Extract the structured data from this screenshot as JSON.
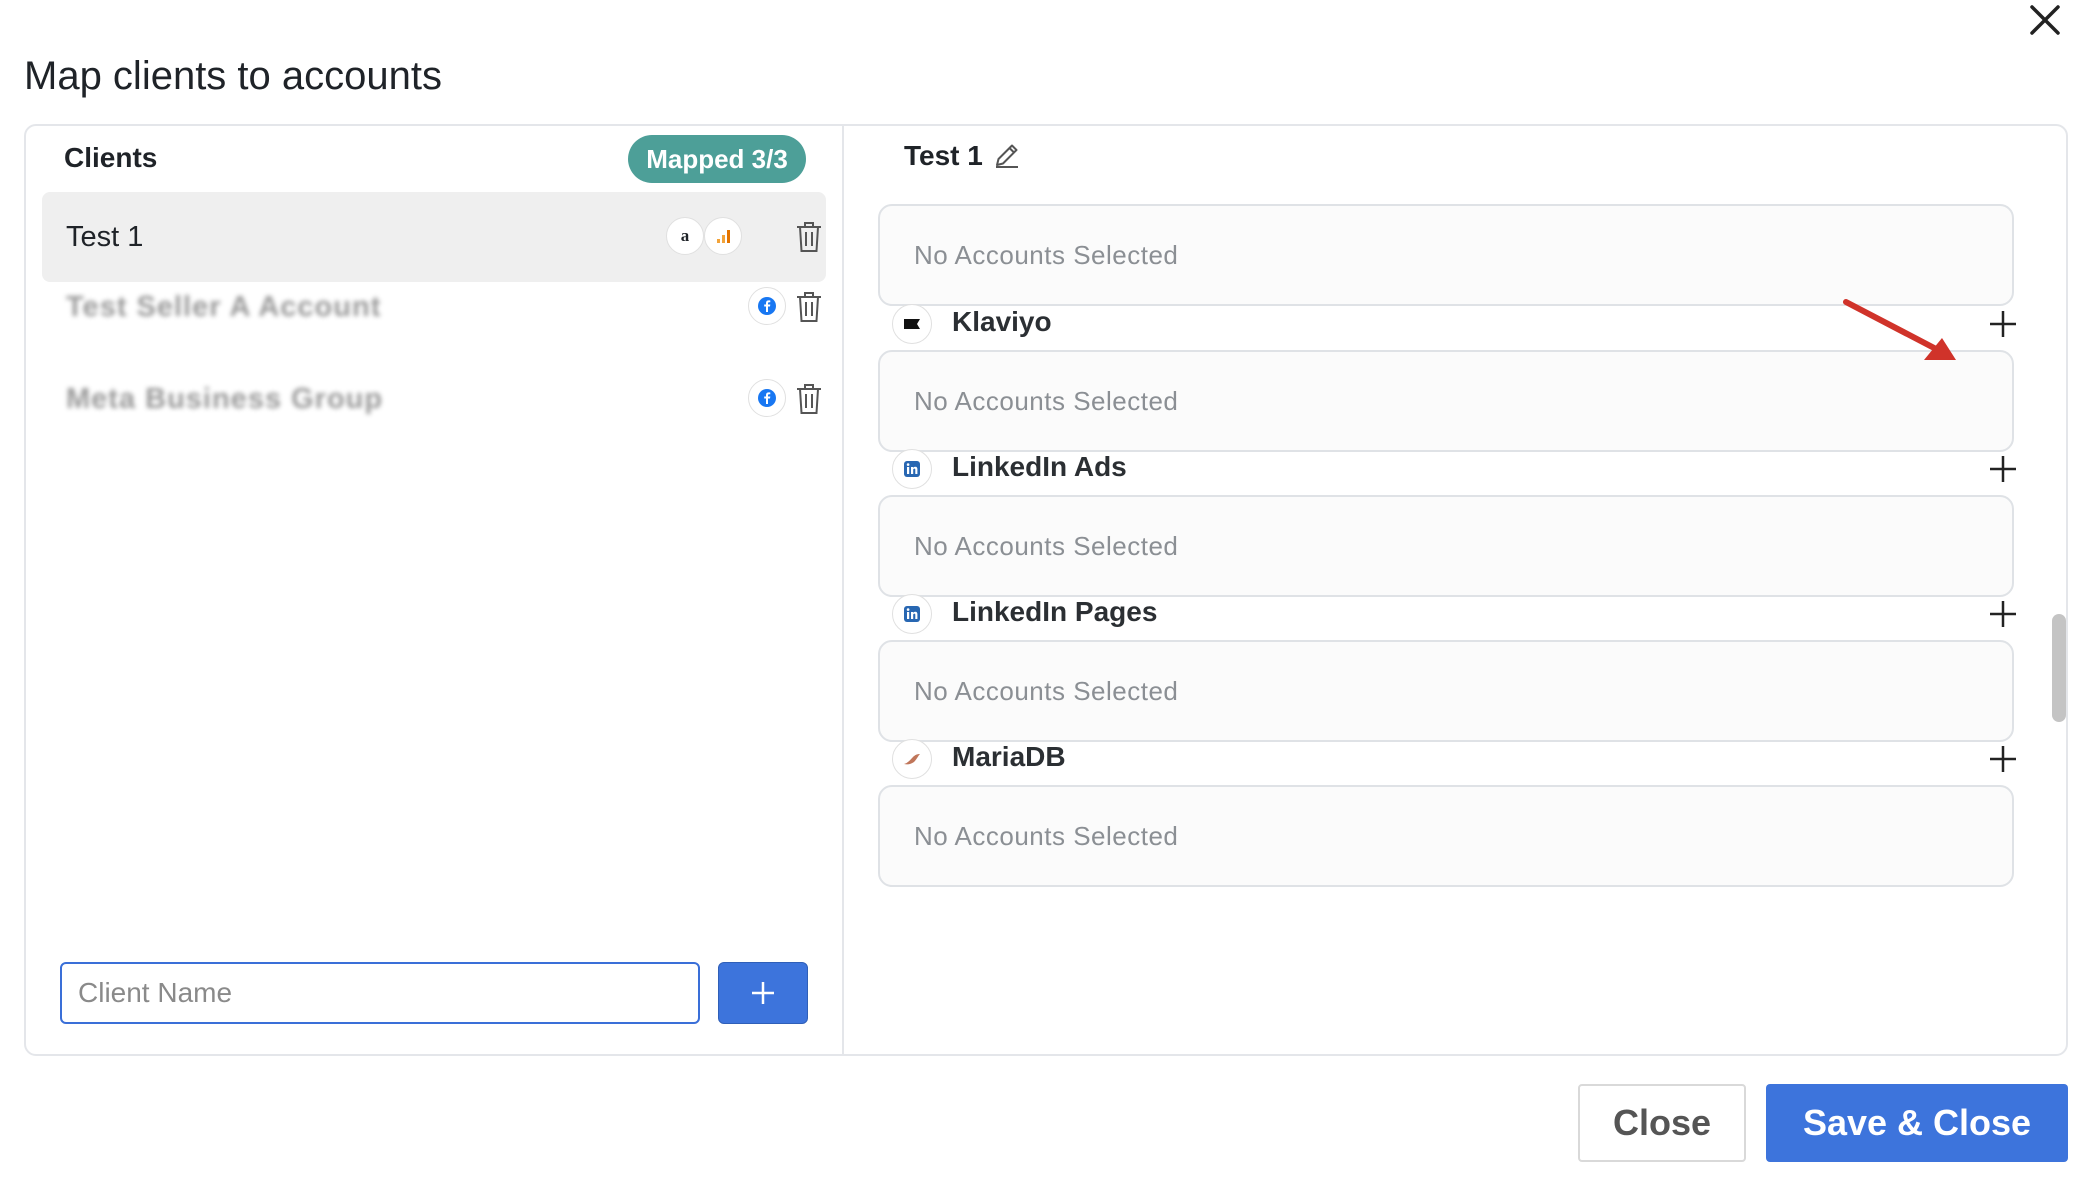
{
  "dialog": {
    "title": "Map clients to accounts"
  },
  "clients_panel": {
    "heading": "Clients",
    "mapped_badge": "Mapped 3/3",
    "clients": [
      {
        "name": "Test 1",
        "icons": [
          "amazon-icon",
          "analytics-icon"
        ],
        "selected": true
      },
      {
        "name": "Test Seller A Account",
        "icons": [
          "facebook-icon"
        ],
        "selected": false
      },
      {
        "name": "Meta Business Group",
        "icons": [
          "facebook-icon"
        ],
        "selected": false
      }
    ],
    "input_placeholder": "Client Name"
  },
  "detail_panel": {
    "client_title": "Test 1",
    "empty_label": "No Accounts Selected",
    "services": [
      {
        "name": "Klaviyo",
        "icon": "klaviyo-icon"
      },
      {
        "name": "LinkedIn Ads",
        "icon": "linkedin-icon"
      },
      {
        "name": "LinkedIn Pages",
        "icon": "linkedin-icon"
      },
      {
        "name": "MariaDB",
        "icon": "mariadb-icon"
      }
    ]
  },
  "footer": {
    "close_label": "Close",
    "save_label": "Save & Close"
  },
  "colors": {
    "primary": "#3d74dc",
    "badge": "#4d9f98",
    "arrow": "#d0332a"
  }
}
